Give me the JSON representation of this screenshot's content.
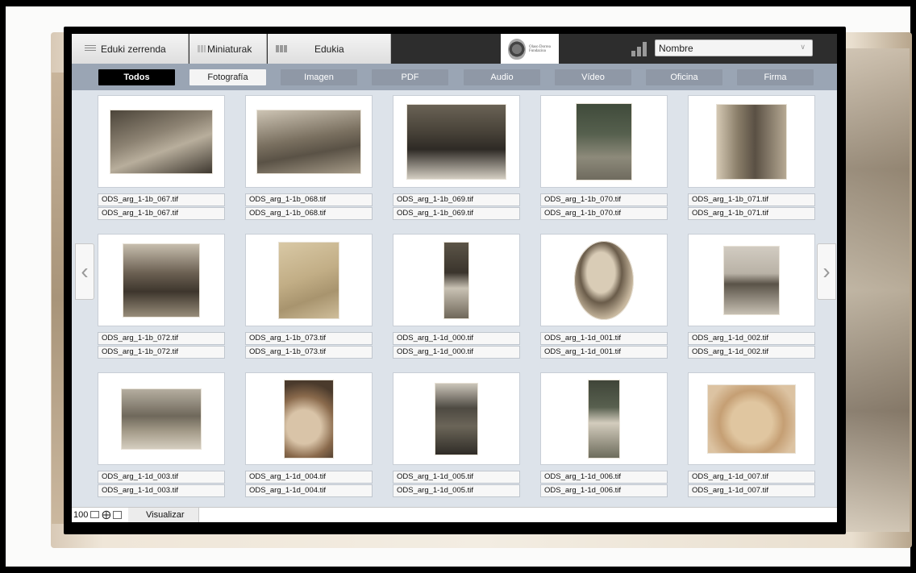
{
  "header": {
    "views": [
      {
        "label": "Eduki zerrenda",
        "icon": "list-view-icon"
      },
      {
        "label": "Miniaturak",
        "icon": "thumbnail-view-icon"
      },
      {
        "label": "Edukia",
        "icon": "content-view-icon"
      }
    ],
    "logo_text": "Olaso Dorrea Fundazioa",
    "sort": {
      "selected": "Nombre",
      "icon": "chevron-down-icon"
    }
  },
  "filters": [
    "Todos",
    "Fotografía",
    "Imagen",
    "PDF",
    "Audio",
    "Vídeo",
    "Oficina",
    "Firma"
  ],
  "active_filter": "Todos",
  "items": [
    {
      "name": "ODS_arg_1-1b_067.tif",
      "name2": "ODS_arg_1-1b_067.tif"
    },
    {
      "name": "ODS_arg_1-1b_068.tif",
      "name2": "ODS_arg_1-1b_068.tif"
    },
    {
      "name": "ODS_arg_1-1b_069.tif",
      "name2": "ODS_arg_1-1b_069.tif"
    },
    {
      "name": "ODS_arg_1-1b_070.tif",
      "name2": "ODS_arg_1-1b_070.tif"
    },
    {
      "name": "ODS_arg_1-1b_071.tif",
      "name2": "ODS_arg_1-1b_071.tif"
    },
    {
      "name": "ODS_arg_1-1b_072.tif",
      "name2": "ODS_arg_1-1b_072.tif"
    },
    {
      "name": "ODS_arg_1-1b_073.tif",
      "name2": "ODS_arg_1-1b_073.tif"
    },
    {
      "name": "ODS_arg_1-1d_000.tif",
      "name2": "ODS_arg_1-1d_000.tif"
    },
    {
      "name": "ODS_arg_1-1d_001.tif",
      "name2": "ODS_arg_1-1d_001.tif"
    },
    {
      "name": "ODS_arg_1-1d_002.tif",
      "name2": "ODS_arg_1-1d_002.tif"
    },
    {
      "name": "ODS_arg_1-1d_003.tif",
      "name2": "ODS_arg_1-1d_003.tif"
    },
    {
      "name": "ODS_arg_1-1d_004.tif",
      "name2": "ODS_arg_1-1d_004.tif"
    },
    {
      "name": "ODS_arg_1-1d_005.tif",
      "name2": "ODS_arg_1-1d_005.tif"
    },
    {
      "name": "ODS_arg_1-1d_006.tif",
      "name2": "ODS_arg_1-1d_006.tif"
    },
    {
      "name": "ODS_arg_1-1d_007.tif",
      "name2": "ODS_arg_1-1d_007.tif"
    }
  ],
  "footer": {
    "zoom": "100",
    "visualizar": "Visualizar"
  },
  "nav": {
    "prev": "‹",
    "next": "›"
  },
  "colors": {
    "accent": "#000000",
    "filter_bar": "#9aa5b4",
    "grid_bg": "#dde3ea"
  }
}
